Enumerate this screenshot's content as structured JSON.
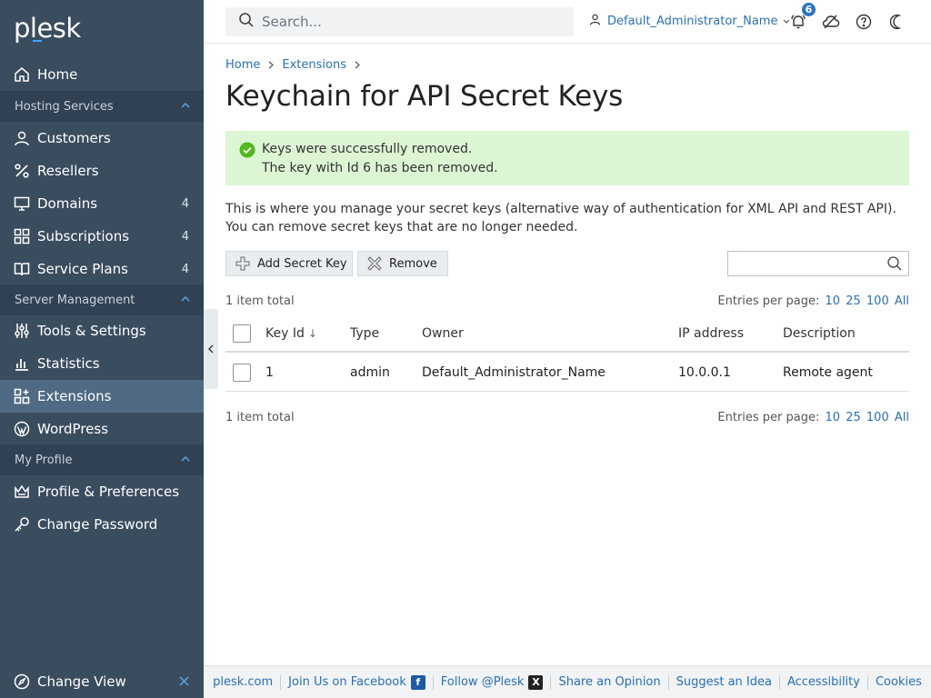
{
  "brand": {
    "logo": "plesk"
  },
  "sidebar": {
    "home": "Home",
    "sections": [
      {
        "label": "Hosting Services"
      },
      {
        "label": "Server Management"
      },
      {
        "label": "My Profile"
      }
    ],
    "hosting": [
      {
        "label": "Customers",
        "count": ""
      },
      {
        "label": "Resellers",
        "count": ""
      },
      {
        "label": "Domains",
        "count": "4"
      },
      {
        "label": "Subscriptions",
        "count": "4"
      },
      {
        "label": "Service Plans",
        "count": "4"
      }
    ],
    "server": [
      {
        "label": "Tools & Settings"
      },
      {
        "label": "Statistics"
      },
      {
        "label": "Extensions"
      },
      {
        "label": "WordPress"
      }
    ],
    "profile": [
      {
        "label": "Profile & Preferences"
      },
      {
        "label": "Change Password"
      }
    ],
    "change_view": "Change View"
  },
  "topbar": {
    "search_placeholder": "Search...",
    "user_name": "Default_Administrator_Name",
    "notification_count": "6"
  },
  "breadcrumb": [
    "Home",
    "Extensions"
  ],
  "page_title": "Keychain for API Secret Keys",
  "message": {
    "line1": "Keys were successfully removed.",
    "line2": "The key with Id 6 has been removed."
  },
  "description": "This is where you manage your secret keys (alternative way of authentication for XML API and REST API). You can remove secret keys that are no longer needed.",
  "toolbar": {
    "add_label": "Add Secret Key",
    "remove_label": "Remove"
  },
  "list": {
    "total": "1 item total",
    "per_page_label": "Entries per page:",
    "per_page_options": [
      "10",
      "25",
      "100",
      "All"
    ],
    "columns": [
      "Key Id",
      "Type",
      "Owner",
      "IP address",
      "Description"
    ],
    "sort_indicator": "↓",
    "rows": [
      {
        "key_id": "1",
        "type": "admin",
        "owner": "Default_Administrator_Name",
        "ip": "10.0.0.1",
        "description": "Remote agent"
      }
    ]
  },
  "footer": {
    "links": [
      "plesk.com",
      "Join Us on Facebook",
      "Follow @Plesk",
      "Share an Opinion",
      "Suggest an Idea",
      "Accessibility",
      "Cookies"
    ]
  },
  "colors": {
    "sidebar_bg": "#3a4d5f",
    "accent": "#2a6fb2",
    "success_bg": "#dcf5d3",
    "success_icon": "#52b81f"
  }
}
